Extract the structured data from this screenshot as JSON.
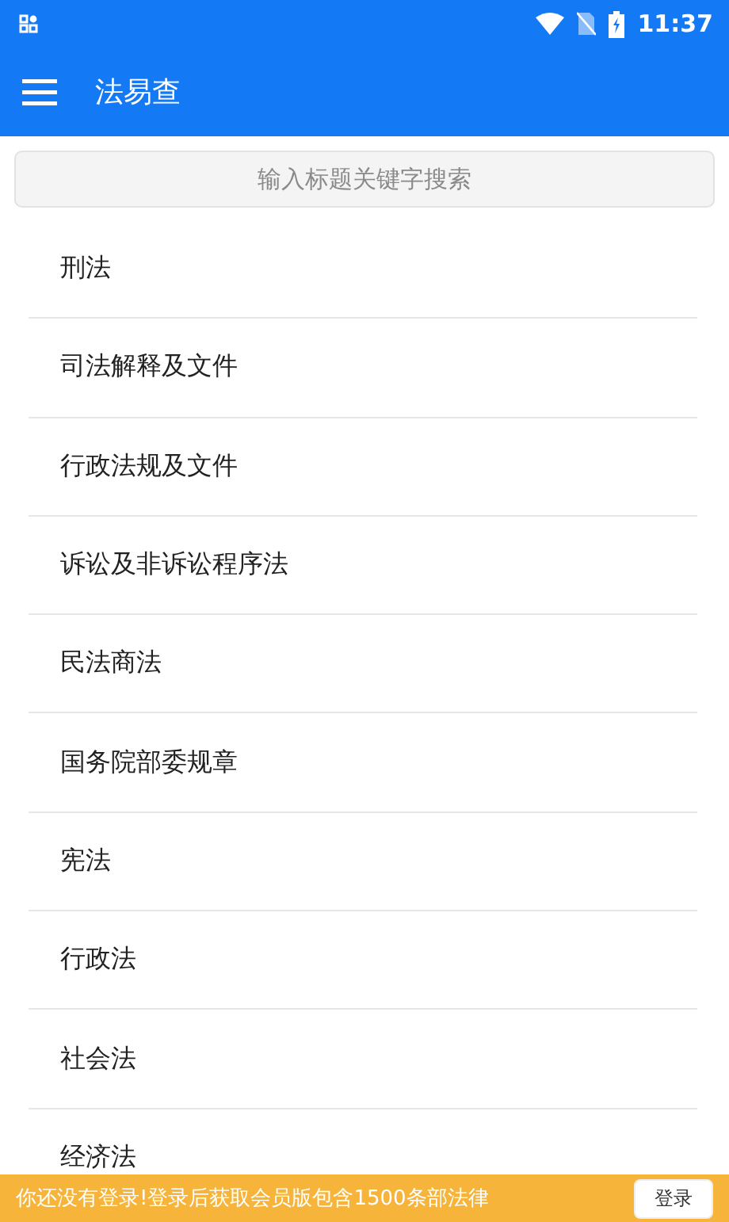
{
  "status_bar": {
    "time": "11:37"
  },
  "app_bar": {
    "title": "法易查"
  },
  "search": {
    "placeholder": "输入标题关键字搜索"
  },
  "categories": [
    {
      "label": "刑法"
    },
    {
      "label": "司法解释及文件"
    },
    {
      "label": "行政法规及文件"
    },
    {
      "label": "诉讼及非诉讼程序法"
    },
    {
      "label": "民法商法"
    },
    {
      "label": "国务院部委规章"
    },
    {
      "label": "宪法"
    },
    {
      "label": "行政法"
    },
    {
      "label": "社会法"
    },
    {
      "label": "经济法"
    }
  ],
  "login_banner": {
    "message": "你还没有登录!登录后获取会员版包含1500条部法律",
    "button": "登录"
  }
}
